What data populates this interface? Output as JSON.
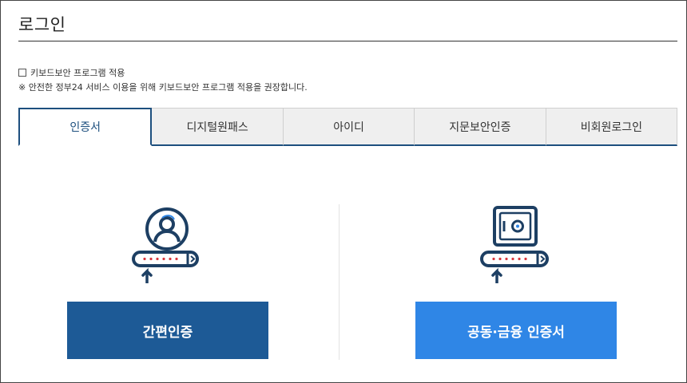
{
  "page": {
    "title": "로그인"
  },
  "keyboard_security": {
    "label": "키보드보안 프로그램 적용",
    "checked": false,
    "notice": "※ 안전한 정부24 서비스 이용을 위해 키보드보안 프로그램 적용을 권장합니다."
  },
  "tabs": [
    {
      "label": "인증서",
      "active": true
    },
    {
      "label": "디지털원패스",
      "active": false
    },
    {
      "label": "아이디",
      "active": false
    },
    {
      "label": "지문보안인증",
      "active": false
    },
    {
      "label": "비회원로그인",
      "active": false
    }
  ],
  "methods": {
    "simple": {
      "label": "간편인증",
      "icon": "user-certificate-icon"
    },
    "certificate": {
      "label": "공동·금융 인증서",
      "icon": "safe-certificate-icon"
    }
  },
  "colors": {
    "navy": "#1d4f7e",
    "simple_button": "#1d5a96",
    "certificate_button": "#2f86e6",
    "dots": "#d9363e"
  }
}
